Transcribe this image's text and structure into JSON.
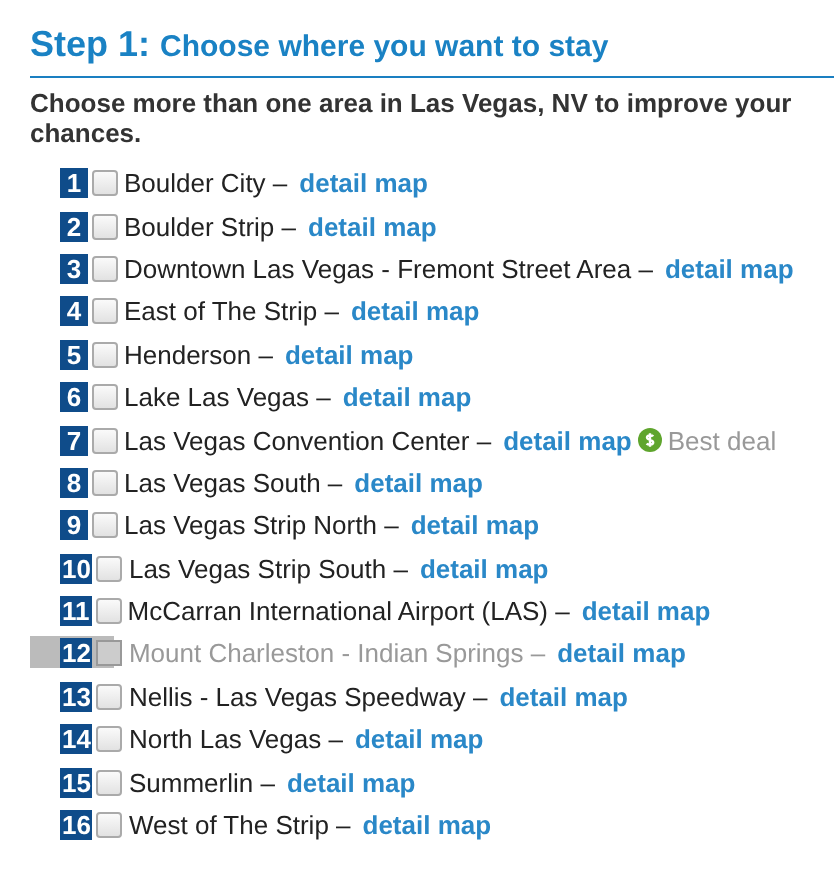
{
  "header": {
    "step": "Step 1:",
    "title": "Choose where you want to stay"
  },
  "description": "Choose more than one area in Las Vegas, NV to improve your chances.",
  "areas": [
    {
      "number": "1",
      "name": "Boulder City",
      "separator": "–",
      "link": "detail map",
      "checked": false,
      "disabled": false
    },
    {
      "number": "2",
      "name": "Boulder Strip",
      "separator": "–",
      "link": "detail map",
      "checked": false,
      "disabled": false
    },
    {
      "number": "3",
      "name": "Downtown Las Vegas - Fremont Street Area",
      "separator": "–",
      "link": "detail map",
      "checked": false,
      "disabled": false
    },
    {
      "number": "4",
      "name": "East of The Strip",
      "separator": "–",
      "link": "detail map",
      "checked": false,
      "disabled": false
    },
    {
      "number": "5",
      "name": "Henderson",
      "separator": "–",
      "link": "detail map",
      "checked": false,
      "disabled": false
    },
    {
      "number": "6",
      "name": "Lake Las Vegas",
      "separator": "–",
      "link": "detail map",
      "checked": false,
      "disabled": false
    },
    {
      "number": "7",
      "name": "Las Vegas Convention Center",
      "separator": "–",
      "link": "detail map",
      "checked": false,
      "disabled": false,
      "deal": "Best deal"
    },
    {
      "number": "8",
      "name": "Las Vegas South",
      "separator": "–",
      "link": "detail map",
      "checked": false,
      "disabled": false
    },
    {
      "number": "9",
      "name": "Las Vegas Strip North",
      "separator": "–",
      "link": "detail map",
      "checked": false,
      "disabled": false
    },
    {
      "number": "10",
      "name": "Las Vegas Strip South",
      "separator": "–",
      "link": "detail map",
      "checked": false,
      "disabled": false
    },
    {
      "number": "11",
      "name": "McCarran International Airport (LAS)",
      "separator": "–",
      "link": "detail map",
      "checked": false,
      "disabled": false
    },
    {
      "number": "12",
      "name": "Mount Charleston - Indian Springs",
      "separator": "–",
      "link": "detail map",
      "checked": false,
      "disabled": true
    },
    {
      "number": "13",
      "name": "Nellis - Las Vegas Speedway",
      "separator": "–",
      "link": "detail map",
      "checked": false,
      "disabled": false
    },
    {
      "number": "14",
      "name": "North Las Vegas",
      "separator": "–",
      "link": "detail map",
      "checked": false,
      "disabled": false
    },
    {
      "number": "15",
      "name": "Summerlin",
      "separator": "–",
      "link": "detail map",
      "checked": false,
      "disabled": false
    },
    {
      "number": "16",
      "name": "West of The Strip",
      "separator": "–",
      "link": "detail map",
      "checked": false,
      "disabled": false
    }
  ]
}
